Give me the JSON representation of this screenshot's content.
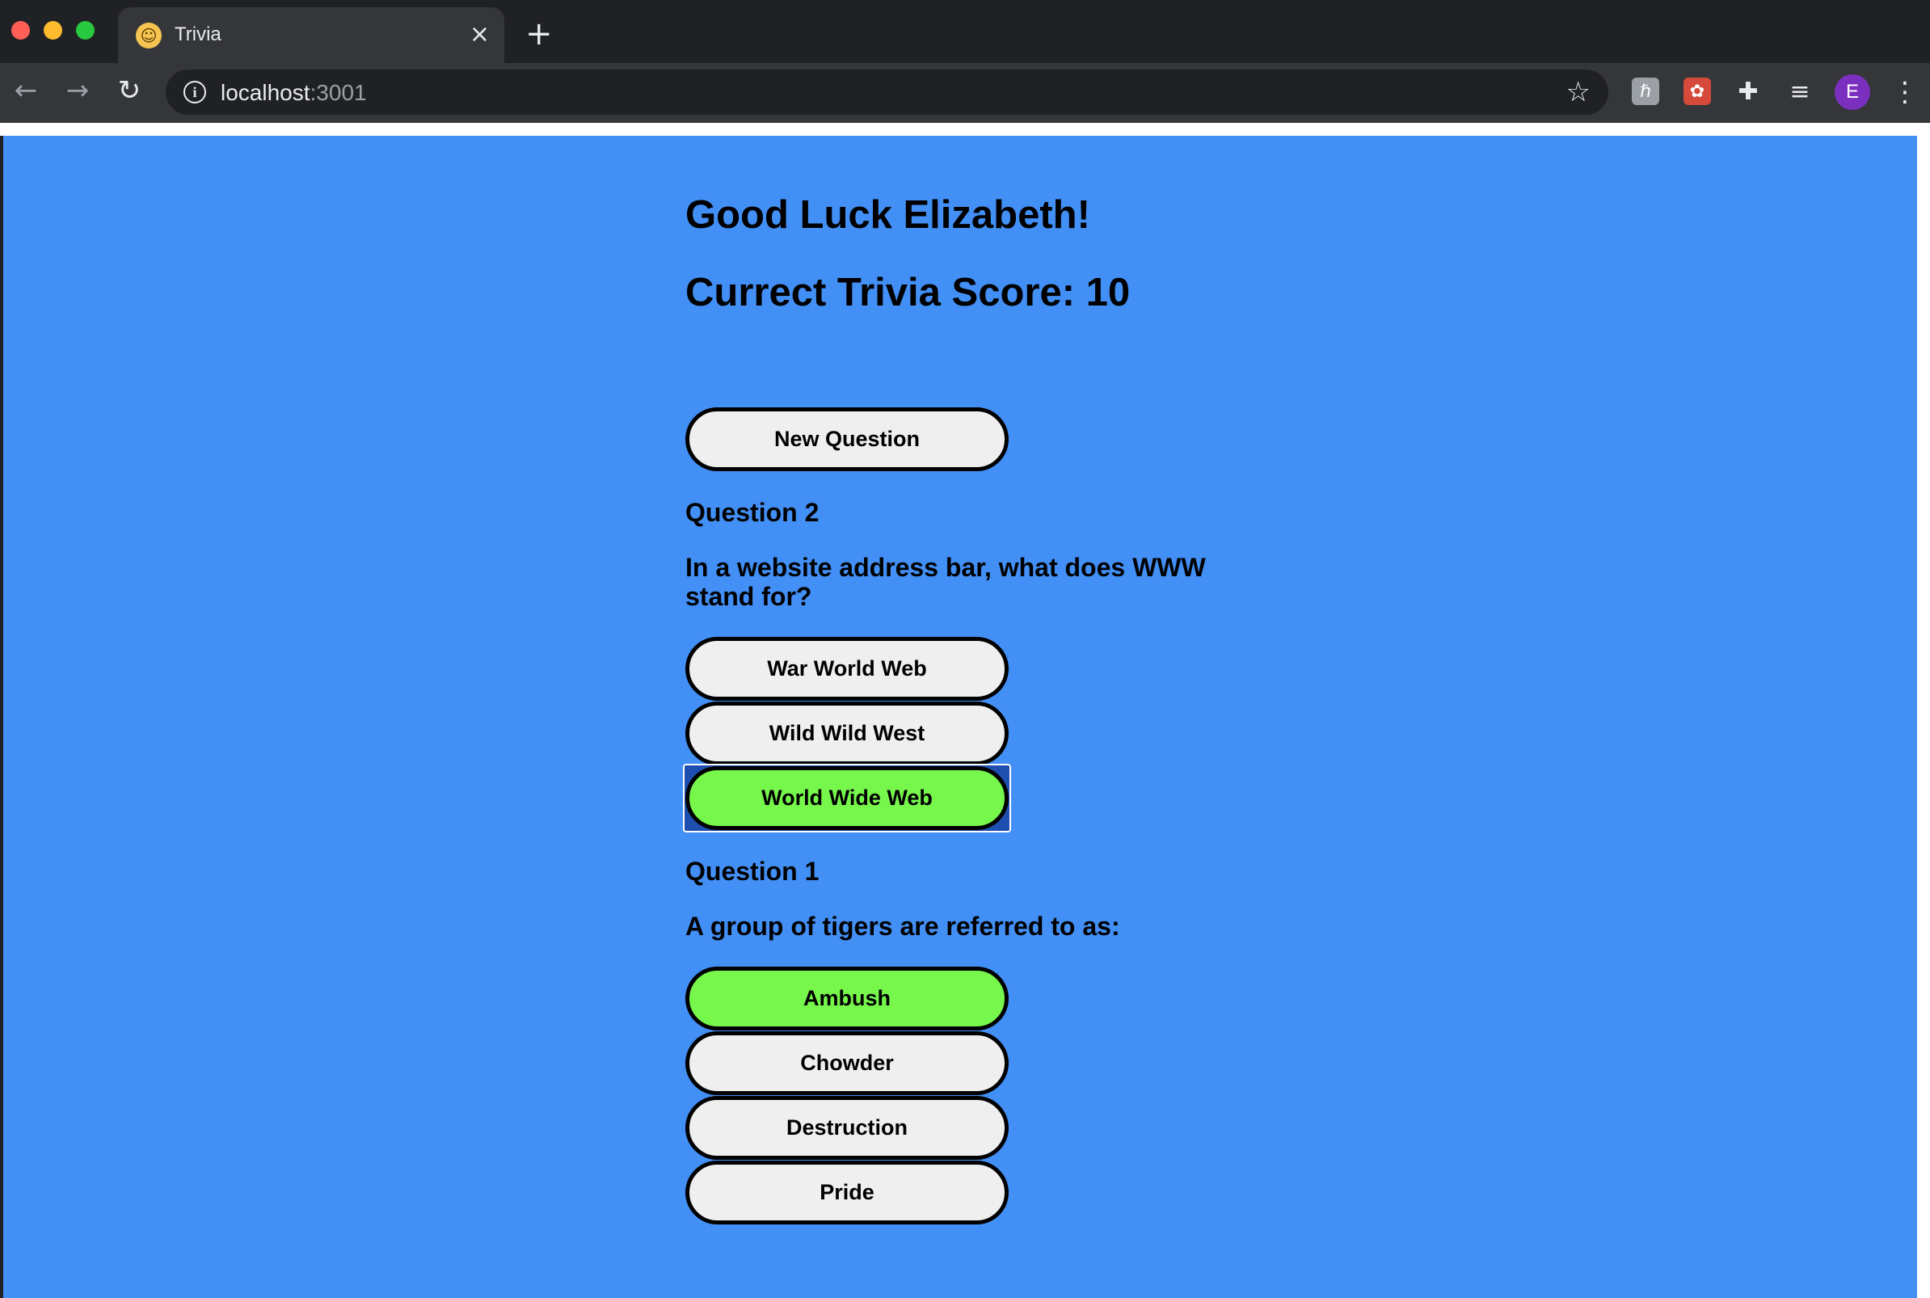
{
  "browser": {
    "tab_title": "Trivia",
    "tab_favicon": "nerd-face-icon",
    "url_host": "localhost",
    "url_port": ":3001",
    "avatar_letter": "E"
  },
  "page": {
    "background": "#428ff6",
    "greeting": "Good Luck Elizabeth!",
    "score_text": "Currect Trivia Score: 10",
    "new_question_label": "New Question",
    "correct_color": "#77f74b"
  },
  "questions": [
    {
      "label": "Question 2",
      "text": "In a website address bar, what does WWW stand for?",
      "answers": [
        {
          "label": "War World Web",
          "state": "default"
        },
        {
          "label": "Wild Wild West",
          "state": "default"
        },
        {
          "label": "World Wide Web",
          "state": "correct-focused"
        }
      ]
    },
    {
      "label": "Question 1",
      "text": "A group of tigers are referred to as:",
      "answers": [
        {
          "label": "Ambush",
          "state": "correct"
        },
        {
          "label": "Chowder",
          "state": "default"
        },
        {
          "label": "Destruction",
          "state": "default"
        },
        {
          "label": "Pride",
          "state": "default"
        }
      ]
    }
  ]
}
